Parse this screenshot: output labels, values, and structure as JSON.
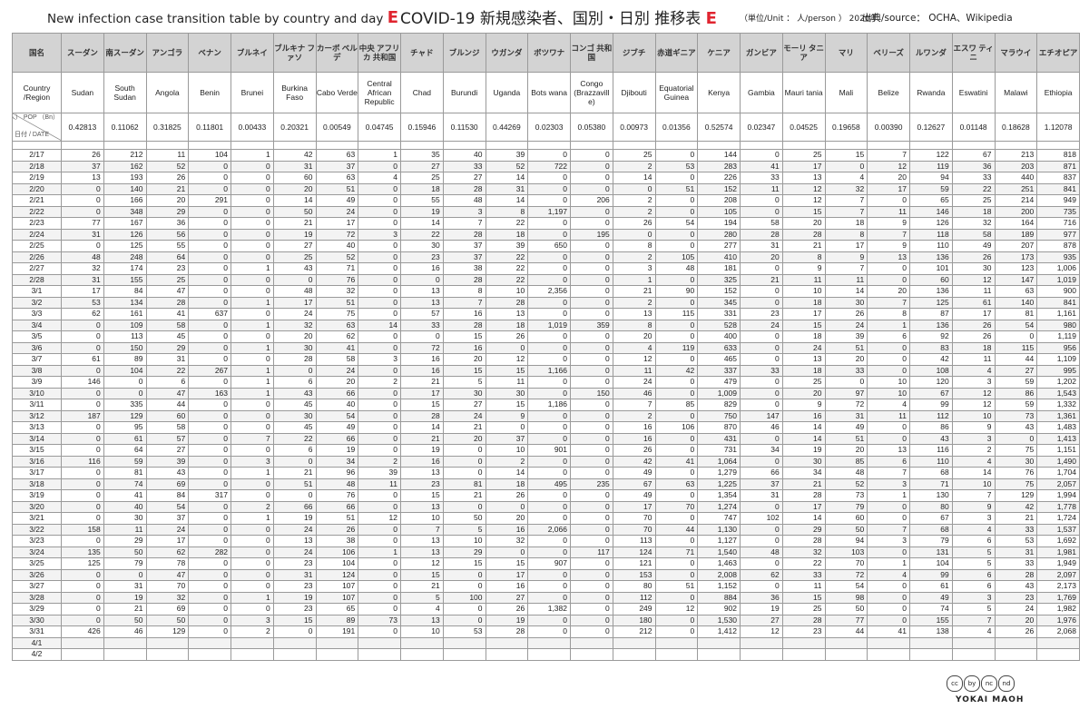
{
  "title": {
    "en": "New infection case transition table by country and day",
    "badge": "E",
    "main": "COVID-19  新規感染者、国別・日別 推移表",
    "unit": "（単位/Unit ： 人/person ） 2020年",
    "source": "出典/source： OCHA、Wikipedia"
  },
  "header": {
    "country_jp_label": "国名",
    "country_en_label": "Country /Region",
    "pop_label": "人口（億人） POP （Bn）",
    "date_label": "日付 / DATE"
  },
  "countries": [
    {
      "jp": "スーダン",
      "en": "Sudan",
      "pop": "0.42813"
    },
    {
      "jp": "南スーダン",
      "en": "South Sudan",
      "pop": "0.11062"
    },
    {
      "jp": "アンゴラ",
      "en": "Angola",
      "pop": "0.31825"
    },
    {
      "jp": "ベナン",
      "en": "Benin",
      "pop": "0.11801"
    },
    {
      "jp": "ブルネイ",
      "en": "Brunei",
      "pop": "0.00433"
    },
    {
      "jp": "ブルキナ ファソ",
      "en": "Burkina Faso",
      "pop": "0.20321"
    },
    {
      "jp": "カーボ ベルデ",
      "en": "Cabo Verde",
      "pop": "0.00549"
    },
    {
      "jp": "中央 アフリカ 共和国",
      "en": "Central African Republic",
      "pop": "0.04745"
    },
    {
      "jp": "チャド",
      "en": "Chad",
      "pop": "0.15946"
    },
    {
      "jp": "ブルンジ",
      "en": "Burundi",
      "pop": "0.11530"
    },
    {
      "jp": "ウガンダ",
      "en": "Uganda",
      "pop": "0.44269"
    },
    {
      "jp": "ボツワナ",
      "en": "Bots wana",
      "pop": "0.02303"
    },
    {
      "jp": "コンゴ 共和国",
      "en": "Congo (Brazzavill e)",
      "pop": "0.05380"
    },
    {
      "jp": "ジブチ",
      "en": "Djibouti",
      "pop": "0.00973"
    },
    {
      "jp": "赤道ギニア",
      "en": "Equatorial Guinea",
      "pop": "0.01356"
    },
    {
      "jp": "ケニア",
      "en": "Kenya",
      "pop": "0.52574"
    },
    {
      "jp": "ガンビア",
      "en": "Gambia",
      "pop": "0.02347"
    },
    {
      "jp": "モーリ タニア",
      "en": "Mauri tania",
      "pop": "0.04525"
    },
    {
      "jp": "マリ",
      "en": "Mali",
      "pop": "0.19658"
    },
    {
      "jp": "ベリーズ",
      "en": "Belize",
      "pop": "0.00390"
    },
    {
      "jp": "ルワンダ",
      "en": "Rwanda",
      "pop": "0.12627"
    },
    {
      "jp": "エスワ ティニ",
      "en": "Eswatini",
      "pop": "0.01148"
    },
    {
      "jp": "マラウイ",
      "en": "Malawi",
      "pop": "0.18628"
    },
    {
      "jp": "エチオピア",
      "en": "Ethiopia",
      "pop": "1.12078"
    }
  ],
  "rows": [
    {
      "date": "2/17",
      "v": [
        "26",
        "212",
        "11",
        "104",
        "1",
        "42",
        "63",
        "1",
        "35",
        "40",
        "39",
        "0",
        "0",
        "25",
        "0",
        "144",
        "0",
        "25",
        "15",
        "7",
        "122",
        "67",
        "213",
        "818"
      ]
    },
    {
      "date": "2/18",
      "v": [
        "37",
        "162",
        "52",
        "0",
        "0",
        "31",
        "37",
        "0",
        "27",
        "33",
        "52",
        "722",
        "0",
        "2",
        "53",
        "283",
        "41",
        "17",
        "0",
        "12",
        "119",
        "36",
        "203",
        "871"
      ]
    },
    {
      "date": "2/19",
      "v": [
        "13",
        "193",
        "26",
        "0",
        "0",
        "60",
        "63",
        "4",
        "25",
        "27",
        "14",
        "0",
        "0",
        "14",
        "0",
        "226",
        "33",
        "13",
        "4",
        "20",
        "94",
        "33",
        "440",
        "837"
      ]
    },
    {
      "date": "2/20",
      "v": [
        "0",
        "140",
        "21",
        "0",
        "0",
        "20",
        "51",
        "0",
        "18",
        "28",
        "31",
        "0",
        "0",
        "0",
        "51",
        "152",
        "11",
        "12",
        "32",
        "17",
        "59",
        "22",
        "251",
        "841"
      ]
    },
    {
      "date": "2/21",
      "v": [
        "0",
        "166",
        "20",
        "291",
        "0",
        "14",
        "49",
        "0",
        "55",
        "48",
        "14",
        "0",
        "206",
        "2",
        "0",
        "208",
        "0",
        "12",
        "7",
        "0",
        "65",
        "25",
        "214",
        "949"
      ]
    },
    {
      "date": "2/22",
      "v": [
        "0",
        "348",
        "29",
        "0",
        "0",
        "50",
        "24",
        "0",
        "19",
        "3",
        "8",
        "1,197",
        "0",
        "2",
        "0",
        "105",
        "0",
        "15",
        "7",
        "11",
        "146",
        "18",
        "200",
        "735"
      ]
    },
    {
      "date": "2/23",
      "v": [
        "77",
        "167",
        "36",
        "0",
        "0",
        "21",
        "17",
        "0",
        "14",
        "7",
        "22",
        "0",
        "0",
        "26",
        "54",
        "194",
        "58",
        "20",
        "18",
        "9",
        "126",
        "32",
        "164",
        "716"
      ]
    },
    {
      "date": "2/24",
      "v": [
        "31",
        "126",
        "56",
        "0",
        "0",
        "19",
        "72",
        "3",
        "22",
        "28",
        "18",
        "0",
        "195",
        "0",
        "0",
        "280",
        "28",
        "28",
        "8",
        "7",
        "118",
        "58",
        "189",
        "977"
      ]
    },
    {
      "date": "2/25",
      "v": [
        "0",
        "125",
        "55",
        "0",
        "0",
        "27",
        "40",
        "0",
        "30",
        "37",
        "39",
        "650",
        "0",
        "8",
        "0",
        "277",
        "31",
        "21",
        "17",
        "9",
        "110",
        "49",
        "207",
        "878"
      ]
    },
    {
      "date": "2/26",
      "v": [
        "48",
        "248",
        "64",
        "0",
        "0",
        "25",
        "52",
        "0",
        "23",
        "37",
        "22",
        "0",
        "0",
        "2",
        "105",
        "410",
        "20",
        "8",
        "9",
        "13",
        "136",
        "26",
        "173",
        "935"
      ]
    },
    {
      "date": "2/27",
      "v": [
        "32",
        "174",
        "23",
        "0",
        "1",
        "43",
        "71",
        "0",
        "16",
        "38",
        "22",
        "0",
        "0",
        "3",
        "48",
        "181",
        "0",
        "9",
        "7",
        "0",
        "101",
        "30",
        "123",
        "1,006"
      ]
    },
    {
      "date": "2/28",
      "v": [
        "31",
        "155",
        "25",
        "0",
        "0",
        "0",
        "76",
        "0",
        "0",
        "28",
        "22",
        "0",
        "0",
        "1",
        "0",
        "325",
        "21",
        "11",
        "11",
        "0",
        "60",
        "12",
        "147",
        "1,019"
      ]
    },
    {
      "date": "3/1",
      "v": [
        "17",
        "84",
        "47",
        "0",
        "0",
        "48",
        "32",
        "0",
        "13",
        "8",
        "10",
        "2,356",
        "0",
        "21",
        "90",
        "152",
        "0",
        "10",
        "14",
        "20",
        "136",
        "11",
        "63",
        "900"
      ]
    },
    {
      "date": "3/2",
      "v": [
        "53",
        "134",
        "28",
        "0",
        "1",
        "17",
        "51",
        "0",
        "13",
        "7",
        "28",
        "0",
        "0",
        "2",
        "0",
        "345",
        "0",
        "18",
        "30",
        "7",
        "125",
        "61",
        "140",
        "841"
      ]
    },
    {
      "date": "3/3",
      "v": [
        "62",
        "161",
        "41",
        "637",
        "0",
        "24",
        "75",
        "0",
        "57",
        "16",
        "13",
        "0",
        "0",
        "13",
        "115",
        "331",
        "23",
        "17",
        "26",
        "8",
        "87",
        "17",
        "81",
        "1,161"
      ]
    },
    {
      "date": "3/4",
      "v": [
        "0",
        "109",
        "58",
        "0",
        "1",
        "32",
        "63",
        "14",
        "33",
        "28",
        "18",
        "1,019",
        "359",
        "8",
        "0",
        "528",
        "24",
        "15",
        "24",
        "1",
        "136",
        "26",
        "54",
        "980"
      ]
    },
    {
      "date": "3/5",
      "v": [
        "0",
        "113",
        "45",
        "0",
        "0",
        "20",
        "62",
        "0",
        "0",
        "15",
        "26",
        "0",
        "0",
        "20",
        "0",
        "400",
        "0",
        "18",
        "39",
        "6",
        "92",
        "26",
        "0",
        "1,119"
      ]
    },
    {
      "date": "3/6",
      "v": [
        "0",
        "150",
        "29",
        "0",
        "1",
        "30",
        "41",
        "0",
        "72",
        "16",
        "0",
        "0",
        "0",
        "4",
        "119",
        "633",
        "0",
        "24",
        "51",
        "0",
        "83",
        "18",
        "115",
        "956"
      ]
    },
    {
      "date": "3/7",
      "v": [
        "61",
        "89",
        "31",
        "0",
        "0",
        "28",
        "58",
        "3",
        "16",
        "20",
        "12",
        "0",
        "0",
        "12",
        "0",
        "465",
        "0",
        "13",
        "20",
        "0",
        "42",
        "11",
        "44",
        "1,109"
      ]
    },
    {
      "date": "3/8",
      "v": [
        "0",
        "104",
        "22",
        "267",
        "1",
        "0",
        "24",
        "0",
        "16",
        "15",
        "15",
        "1,166",
        "0",
        "11",
        "42",
        "337",
        "33",
        "18",
        "33",
        "0",
        "108",
        "4",
        "27",
        "995"
      ]
    },
    {
      "date": "3/9",
      "v": [
        "146",
        "0",
        "6",
        "0",
        "1",
        "6",
        "20",
        "2",
        "21",
        "5",
        "11",
        "0",
        "0",
        "24",
        "0",
        "479",
        "0",
        "25",
        "0",
        "10",
        "120",
        "3",
        "59",
        "1,202"
      ]
    },
    {
      "date": "3/10",
      "v": [
        "0",
        "0",
        "47",
        "163",
        "1",
        "43",
        "66",
        "0",
        "17",
        "30",
        "30",
        "0",
        "150",
        "46",
        "0",
        "1,009",
        "0",
        "20",
        "97",
        "10",
        "67",
        "12",
        "86",
        "1,543"
      ]
    },
    {
      "date": "3/11",
      "v": [
        "0",
        "335",
        "44",
        "0",
        "0",
        "45",
        "40",
        "0",
        "15",
        "27",
        "15",
        "1,186",
        "0",
        "7",
        "85",
        "829",
        "0",
        "9",
        "72",
        "4",
        "99",
        "12",
        "59",
        "1,332"
      ]
    },
    {
      "date": "3/12",
      "v": [
        "187",
        "129",
        "60",
        "0",
        "0",
        "30",
        "54",
        "0",
        "28",
        "24",
        "9",
        "0",
        "0",
        "2",
        "0",
        "750",
        "147",
        "16",
        "31",
        "11",
        "112",
        "10",
        "73",
        "1,361"
      ]
    },
    {
      "date": "3/13",
      "v": [
        "0",
        "95",
        "58",
        "0",
        "0",
        "45",
        "49",
        "0",
        "14",
        "21",
        "0",
        "0",
        "0",
        "16",
        "106",
        "870",
        "46",
        "14",
        "49",
        "0",
        "86",
        "9",
        "43",
        "1,483"
      ]
    },
    {
      "date": "3/14",
      "v": [
        "0",
        "61",
        "57",
        "0",
        "7",
        "22",
        "66",
        "0",
        "21",
        "20",
        "37",
        "0",
        "0",
        "16",
        "0",
        "431",
        "0",
        "14",
        "51",
        "0",
        "43",
        "3",
        "0",
        "1,413"
      ]
    },
    {
      "date": "3/15",
      "v": [
        "0",
        "64",
        "27",
        "0",
        "0",
        "6",
        "19",
        "0",
        "19",
        "0",
        "10",
        "901",
        "0",
        "26",
        "0",
        "731",
        "34",
        "19",
        "20",
        "13",
        "116",
        "2",
        "75",
        "1,151"
      ]
    },
    {
      "date": "3/16",
      "v": [
        "116",
        "59",
        "39",
        "0",
        "3",
        "0",
        "34",
        "2",
        "16",
        "0",
        "2",
        "0",
        "0",
        "42",
        "41",
        "1,064",
        "0",
        "30",
        "85",
        "6",
        "110",
        "4",
        "30",
        "1,490"
      ]
    },
    {
      "date": "3/17",
      "v": [
        "0",
        "81",
        "43",
        "0",
        "1",
        "21",
        "96",
        "39",
        "13",
        "0",
        "14",
        "0",
        "0",
        "49",
        "0",
        "1,279",
        "66",
        "34",
        "48",
        "7",
        "68",
        "14",
        "76",
        "1,704"
      ]
    },
    {
      "date": "3/18",
      "v": [
        "0",
        "74",
        "69",
        "0",
        "0",
        "51",
        "48",
        "11",
        "23",
        "81",
        "18",
        "495",
        "235",
        "67",
        "63",
        "1,225",
        "37",
        "21",
        "52",
        "3",
        "71",
        "10",
        "75",
        "2,057"
      ]
    },
    {
      "date": "3/19",
      "v": [
        "0",
        "41",
        "84",
        "317",
        "0",
        "0",
        "76",
        "0",
        "15",
        "21",
        "26",
        "0",
        "0",
        "49",
        "0",
        "1,354",
        "31",
        "28",
        "73",
        "1",
        "130",
        "7",
        "129",
        "1,994"
      ]
    },
    {
      "date": "3/20",
      "v": [
        "0",
        "40",
        "54",
        "0",
        "2",
        "66",
        "66",
        "0",
        "13",
        "0",
        "0",
        "0",
        "0",
        "17",
        "70",
        "1,274",
        "0",
        "17",
        "79",
        "0",
        "80",
        "9",
        "42",
        "1,778"
      ]
    },
    {
      "date": "3/21",
      "v": [
        "0",
        "30",
        "37",
        "0",
        "1",
        "19",
        "51",
        "12",
        "10",
        "50",
        "20",
        "0",
        "0",
        "70",
        "0",
        "747",
        "102",
        "14",
        "60",
        "0",
        "67",
        "3",
        "21",
        "1,724"
      ]
    },
    {
      "date": "3/22",
      "v": [
        "158",
        "11",
        "24",
        "0",
        "0",
        "24",
        "26",
        "0",
        "7",
        "5",
        "16",
        "2,066",
        "0",
        "70",
        "44",
        "1,130",
        "0",
        "29",
        "50",
        "7",
        "68",
        "4",
        "33",
        "1,537"
      ]
    },
    {
      "date": "3/23",
      "v": [
        "0",
        "29",
        "17",
        "0",
        "0",
        "13",
        "38",
        "0",
        "13",
        "10",
        "32",
        "0",
        "0",
        "113",
        "0",
        "1,127",
        "0",
        "28",
        "94",
        "3",
        "79",
        "6",
        "53",
        "1,692"
      ]
    },
    {
      "date": "3/24",
      "v": [
        "135",
        "50",
        "62",
        "282",
        "0",
        "24",
        "106",
        "1",
        "13",
        "29",
        "0",
        "0",
        "117",
        "124",
        "71",
        "1,540",
        "48",
        "32",
        "103",
        "0",
        "131",
        "5",
        "31",
        "1,981"
      ]
    },
    {
      "date": "3/25",
      "v": [
        "125",
        "79",
        "78",
        "0",
        "0",
        "23",
        "104",
        "0",
        "12",
        "15",
        "15",
        "907",
        "0",
        "121",
        "0",
        "1,463",
        "0",
        "22",
        "70",
        "1",
        "104",
        "5",
        "33",
        "1,949"
      ]
    },
    {
      "date": "3/26",
      "v": [
        "0",
        "0",
        "47",
        "0",
        "0",
        "31",
        "124",
        "0",
        "15",
        "0",
        "17",
        "0",
        "0",
        "153",
        "0",
        "2,008",
        "62",
        "33",
        "72",
        "4",
        "99",
        "6",
        "28",
        "2,097"
      ]
    },
    {
      "date": "3/27",
      "v": [
        "0",
        "31",
        "70",
        "0",
        "0",
        "23",
        "107",
        "0",
        "21",
        "0",
        "16",
        "0",
        "0",
        "80",
        "51",
        "1,152",
        "0",
        "11",
        "54",
        "0",
        "61",
        "6",
        "43",
        "2,173"
      ]
    },
    {
      "date": "3/28",
      "v": [
        "0",
        "19",
        "32",
        "0",
        "1",
        "19",
        "107",
        "0",
        "5",
        "100",
        "27",
        "0",
        "0",
        "112",
        "0",
        "884",
        "36",
        "15",
        "98",
        "0",
        "49",
        "3",
        "23",
        "1,769"
      ]
    },
    {
      "date": "3/29",
      "v": [
        "0",
        "21",
        "69",
        "0",
        "0",
        "23",
        "65",
        "0",
        "4",
        "0",
        "26",
        "1,382",
        "0",
        "249",
        "12",
        "902",
        "19",
        "25",
        "50",
        "0",
        "74",
        "5",
        "24",
        "1,982"
      ]
    },
    {
      "date": "3/30",
      "v": [
        "0",
        "50",
        "50",
        "0",
        "3",
        "15",
        "89",
        "73",
        "13",
        "0",
        "19",
        "0",
        "0",
        "180",
        "0",
        "1,530",
        "27",
        "28",
        "77",
        "0",
        "155",
        "7",
        "20",
        "1,976"
      ]
    },
    {
      "date": "3/31",
      "v": [
        "426",
        "46",
        "129",
        "0",
        "2",
        "0",
        "191",
        "0",
        "10",
        "53",
        "28",
        "0",
        "0",
        "212",
        "0",
        "1,412",
        "12",
        "23",
        "44",
        "41",
        "138",
        "4",
        "26",
        "2,068"
      ]
    },
    {
      "date": "4/1",
      "v": [
        "",
        "",
        "",
        "",
        "",
        "",
        "",
        "",
        "",
        "",
        "",
        "",
        "",
        "",
        "",
        "",
        "",
        "",
        "",
        "",
        "",
        "",
        "",
        ""
      ]
    },
    {
      "date": "4/2",
      "v": [
        "",
        "",
        "",
        "",
        "",
        "",
        "",
        "",
        "",
        "",
        "",
        "",
        "",
        "",
        "",
        "",
        "",
        "",
        "",
        "",
        "",
        "",
        "",
        ""
      ]
    }
  ],
  "footer": {
    "cc_icons": [
      "cc",
      "by",
      "nc",
      "nd"
    ],
    "brand": "YOKAI MAOH"
  }
}
